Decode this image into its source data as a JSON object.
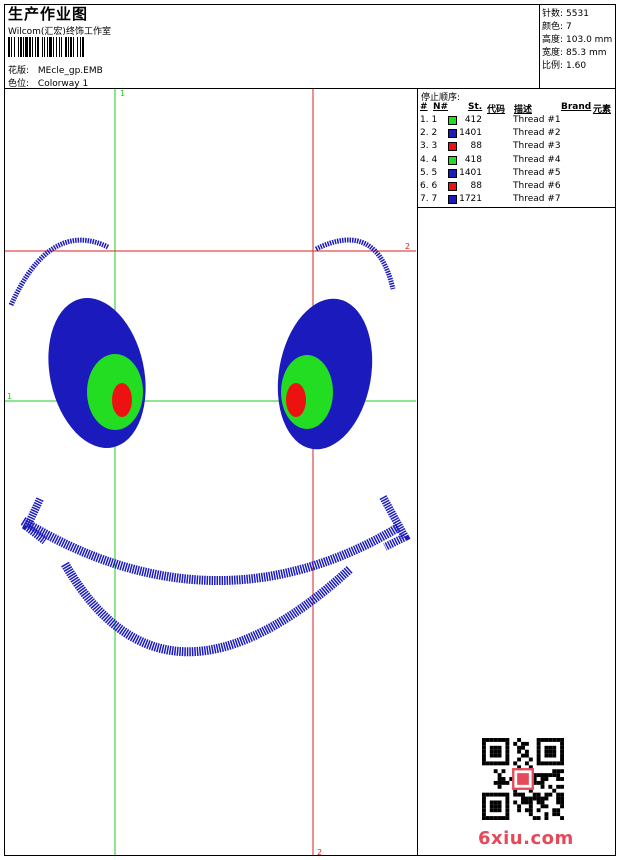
{
  "header": {
    "title": "生产作业图",
    "company": "Wilcom(汇宏)终饰工作室",
    "design_label": "花版:",
    "design_file": "MEcle_gp.EMB",
    "colorway_label": "色位:",
    "colorway": "Colorway 1"
  },
  "stats": [
    {
      "label": "针数:",
      "value": "5531"
    },
    {
      "label": "颜色:",
      "value": "7"
    },
    {
      "label": "高度:",
      "value": "103.0 mm"
    },
    {
      "label": "宽度:",
      "value": "85.3 mm"
    },
    {
      "label": "比例:",
      "value": "1.60"
    }
  ],
  "stop_sequence": {
    "title": "停止顺序:",
    "columns": {
      "hash": "#",
      "n": "N#",
      "st": "St.",
      "code": "代码",
      "desc": "描述",
      "brand": "Brand",
      "elem": "元素"
    },
    "rows": [
      {
        "idx": "1. 1",
        "color": "#22dd22",
        "code": "412",
        "desc": "Thread #1"
      },
      {
        "idx": "2. 2",
        "color": "#1b1bbd",
        "code": "1401",
        "desc": "Thread #2"
      },
      {
        "idx": "3. 3",
        "color": "#ee1111",
        "code": "88",
        "desc": "Thread #3"
      },
      {
        "idx": "4. 4",
        "color": "#22dd22",
        "code": "418",
        "desc": "Thread #4"
      },
      {
        "idx": "5. 5",
        "color": "#1b1bbd",
        "code": "1401",
        "desc": "Thread #5"
      },
      {
        "idx": "6. 6",
        "color": "#ee1111",
        "code": "88",
        "desc": "Thread #6"
      },
      {
        "idx": "7. 7",
        "color": "#1b1bbd",
        "code": "1721",
        "desc": "Thread #7"
      }
    ]
  },
  "guides": {
    "v1": "1",
    "h1": "1",
    "h2": "2",
    "v2": "2"
  },
  "colors": {
    "blue": "#1b1bbd",
    "green": "#22dd22",
    "red": "#ee1111",
    "guide_green": "#22cc22",
    "guide_red": "#dd2222",
    "brand": "#e64a5a"
  },
  "watermark": {
    "text": "6xiu.com",
    "qr": "qr-code-icon"
  }
}
